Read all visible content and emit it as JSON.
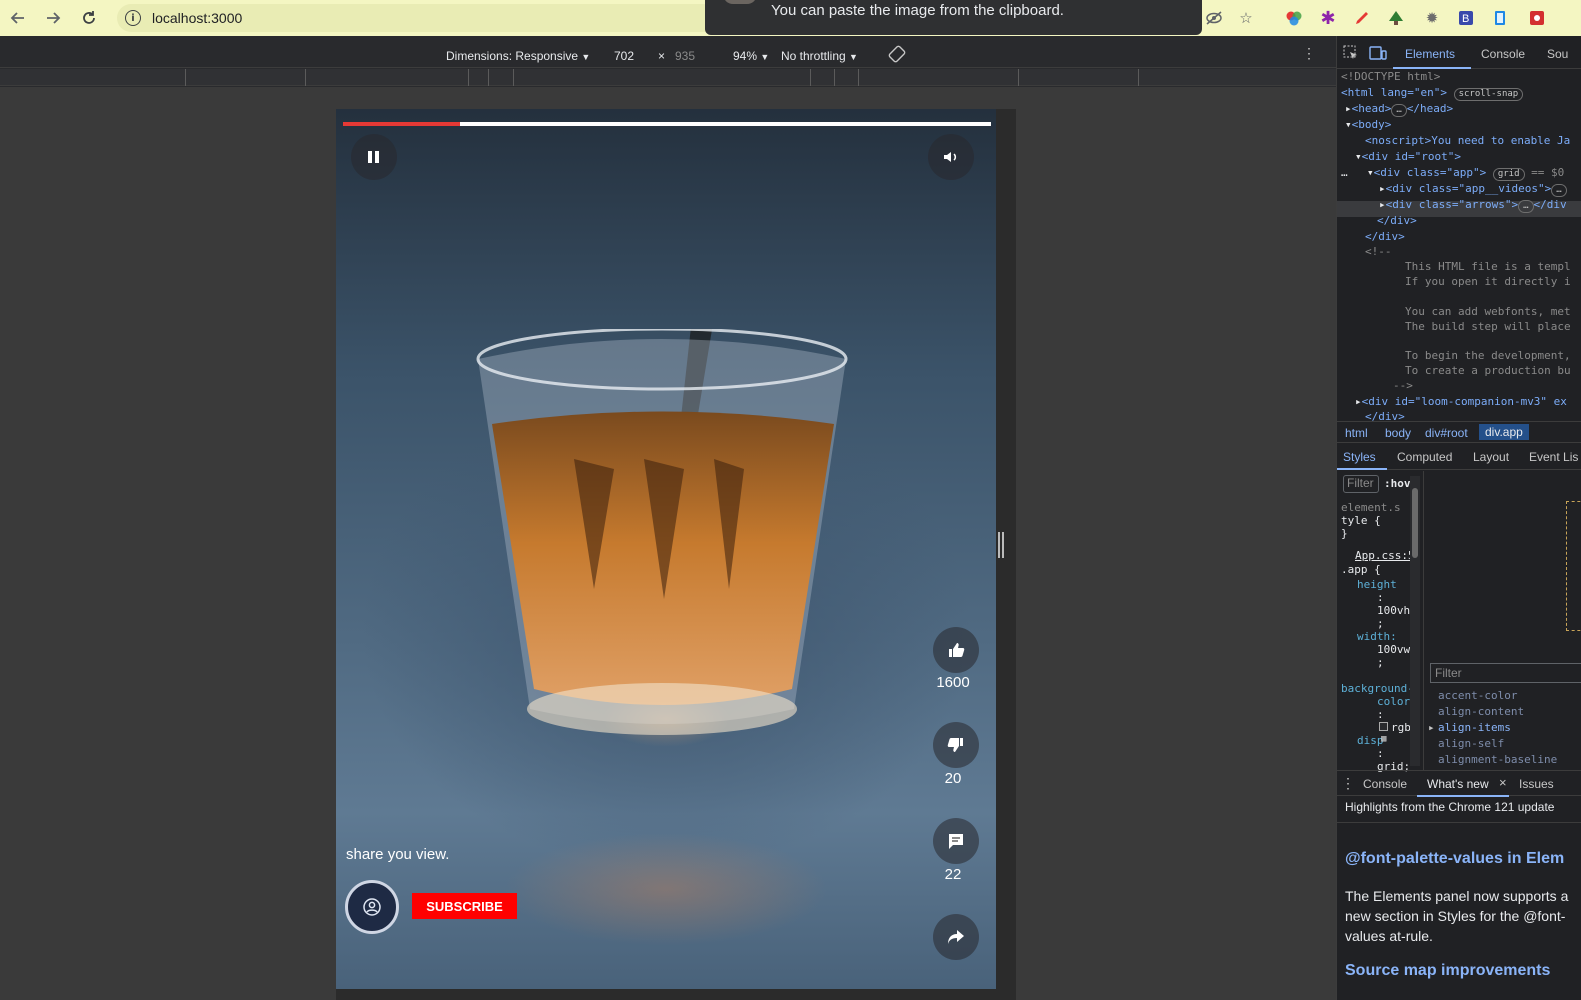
{
  "browser": {
    "url": "localhost:3000",
    "toast": "You can paste the image from the clipboard."
  },
  "device_toolbar": {
    "dimensions_label": "Dimensions: Responsive",
    "width": "702",
    "times": "×",
    "height": "935",
    "zoom": "94%",
    "throttling": "No throttling"
  },
  "video": {
    "progress_fraction": 0.18,
    "caption": "share you view.",
    "subscribe_label": "SUBSCRIBE",
    "likes": "1600",
    "dislikes": "20",
    "comments": "22"
  },
  "devtools": {
    "tabs": [
      "Elements",
      "Console",
      "Sou"
    ],
    "dom": {
      "doctype": "<!DOCTYPE html>",
      "html_tag": "<html lang=\"en\">",
      "scroll_snap": "scroll-snap",
      "head": "<head>",
      "head_close": "</head>",
      "body": "<body>",
      "noscript": "<noscript>You need to enable Ja",
      "root": "<div id=\"root\">",
      "app": "<div class=\"app\">",
      "grid": "grid",
      "eq": "== $0",
      "videos": "<div class=\"app__videos\">",
      "arrows": "<div class=\"arrows\">",
      "arrows_close": "</div",
      "div_close": "</div>",
      "comment_open": "<!--",
      "comment_1": "This HTML file is a templ",
      "comment_2": "If you open it directly i",
      "comment_3": "You can add webfonts, met",
      "comment_4": "The build step will place",
      "comment_5": "To begin the development,",
      "comment_6": "To create a production bu",
      "comment_close": "-->",
      "loom": "<div id=\"loom-companion-mv3\" ex",
      "loom_close": "</div>"
    },
    "breadcrumbs": [
      "html",
      "body",
      "div#root",
      "div.app"
    ],
    "style_tabs": [
      "Styles",
      "Computed",
      "Layout",
      "Event Lis"
    ],
    "styles": {
      "filter": "Filter",
      "hov": ":hov",
      "element_style_1": "element.s",
      "element_style_2": "tyle {",
      "brace": "}",
      "source": "App.css:5",
      "selector": ".app {",
      "prop_height": "height",
      "colon": ":",
      "val_height": "100vh",
      "semi": ";",
      "prop_width": "width:",
      "val_width": "100vw",
      "prop_bg_1": "background-",
      "prop_bg_2": "color",
      "val_bg": "rgb(",
      "prop_display": "disp",
      "val_display": "grid;"
    },
    "computed": {
      "filter": "Filter",
      "properties": [
        "accent-color",
        "align-content",
        "align-items",
        "align-self",
        "alignment-baseline"
      ]
    },
    "drawer_tabs": [
      "Console",
      "What's new",
      "Issues"
    ],
    "whats_new": {
      "subtitle": "Highlights from the Chrome 121 update",
      "heading_1": "@font-palette-values in Elem",
      "paragraph": "The Elements panel now supports a new section in Styles for the @font-values at-rule.",
      "heading_2": "Source map improvements"
    }
  },
  "colors": {
    "chrome_bar": "#f4f6c2",
    "progress_fill": "#e53935",
    "subscribe": "#ff0000",
    "devtools_accent": "#8ab4f8"
  }
}
